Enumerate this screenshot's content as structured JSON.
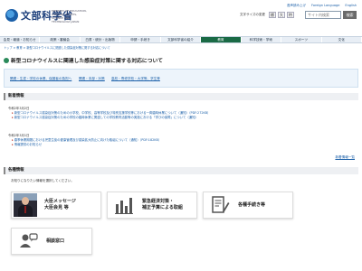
{
  "header": {
    "logo_text": "文部科学省",
    "logo_sub": "MINISTRY OF EDUCATION, CULTURE, SPORTS, SCIENCE AND TECHNOLOGY-JAPAN",
    "util_links": [
      "音声読み上げ",
      "Foreign Language",
      "English"
    ],
    "font_size_label": "文字サイズの変更",
    "font_sizes": [
      "標",
      "大",
      "特"
    ],
    "search_placeholder": "サイト内検索",
    "search_button": "検索"
  },
  "gnav": {
    "items": [
      "会見・報道・お知らせ",
      "政策・審議会",
      "白書・統計・出版物",
      "申請・手続き",
      "文部科学省の紹介",
      "教育",
      "科学技術・学術",
      "スポーツ",
      "文化"
    ],
    "active_index": 5
  },
  "breadcrumb": "トップ > 教育 > 新型コロナウイルスに関連した感染症対策に関する対応について",
  "page_title": "新型コロナウイルスに関連した感染症対策に関する対応について",
  "links": [
    {
      "label": "関連・生涯・学校の休業、保護者の負担へ"
    },
    {
      "label": "関連・本部・対策"
    },
    {
      "label": "高校・専修学校・大学等、学生等"
    }
  ],
  "news": {
    "heading": "新着情報",
    "groups": [
      {
        "date": "令和2年3月2日",
        "items": [
          "新型コロナウイルス感染症対策のための小学校、中学校、高等学校及び特別支援学校等における一斉臨時休業について（通知）（PDF:272KB）",
          "新型コロナウイルス感染症対策のための学校の臨時休業に関連しての学校教育活動等の実施における「学びの保障」について（通知）"
        ]
      },
      {
        "date": "令和2年3月1日",
        "items": [
          "春季休業期間における児童生徒の健康管理及び感染拡大防止に向けた取組について（通知）（PDF:182KB）",
          "情報提供のお知らせ"
        ]
      }
    ],
    "more_label": "新着情報一覧"
  },
  "info": {
    "heading": "各種情報",
    "note": "お知りになりたい情報を選択してください。",
    "cards": [
      {
        "label": "大臣メッセージ\n大臣会見 等",
        "icon": "minister-photo"
      },
      {
        "label": "緊急経済対策・\n補正予算による取組",
        "icon": "bar-chart-icon"
      },
      {
        "label": "各種手続き等",
        "icon": "document-pencil-icon"
      },
      {
        "label": "相談窓口",
        "icon": "consultation-icon"
      }
    ]
  },
  "colors": {
    "brand": "#1a3d7a",
    "link": "#1a5fa8",
    "nav_active": "#1a6a45",
    "link_box_bg": "#edf4fb",
    "pdf": "#c0392b"
  }
}
